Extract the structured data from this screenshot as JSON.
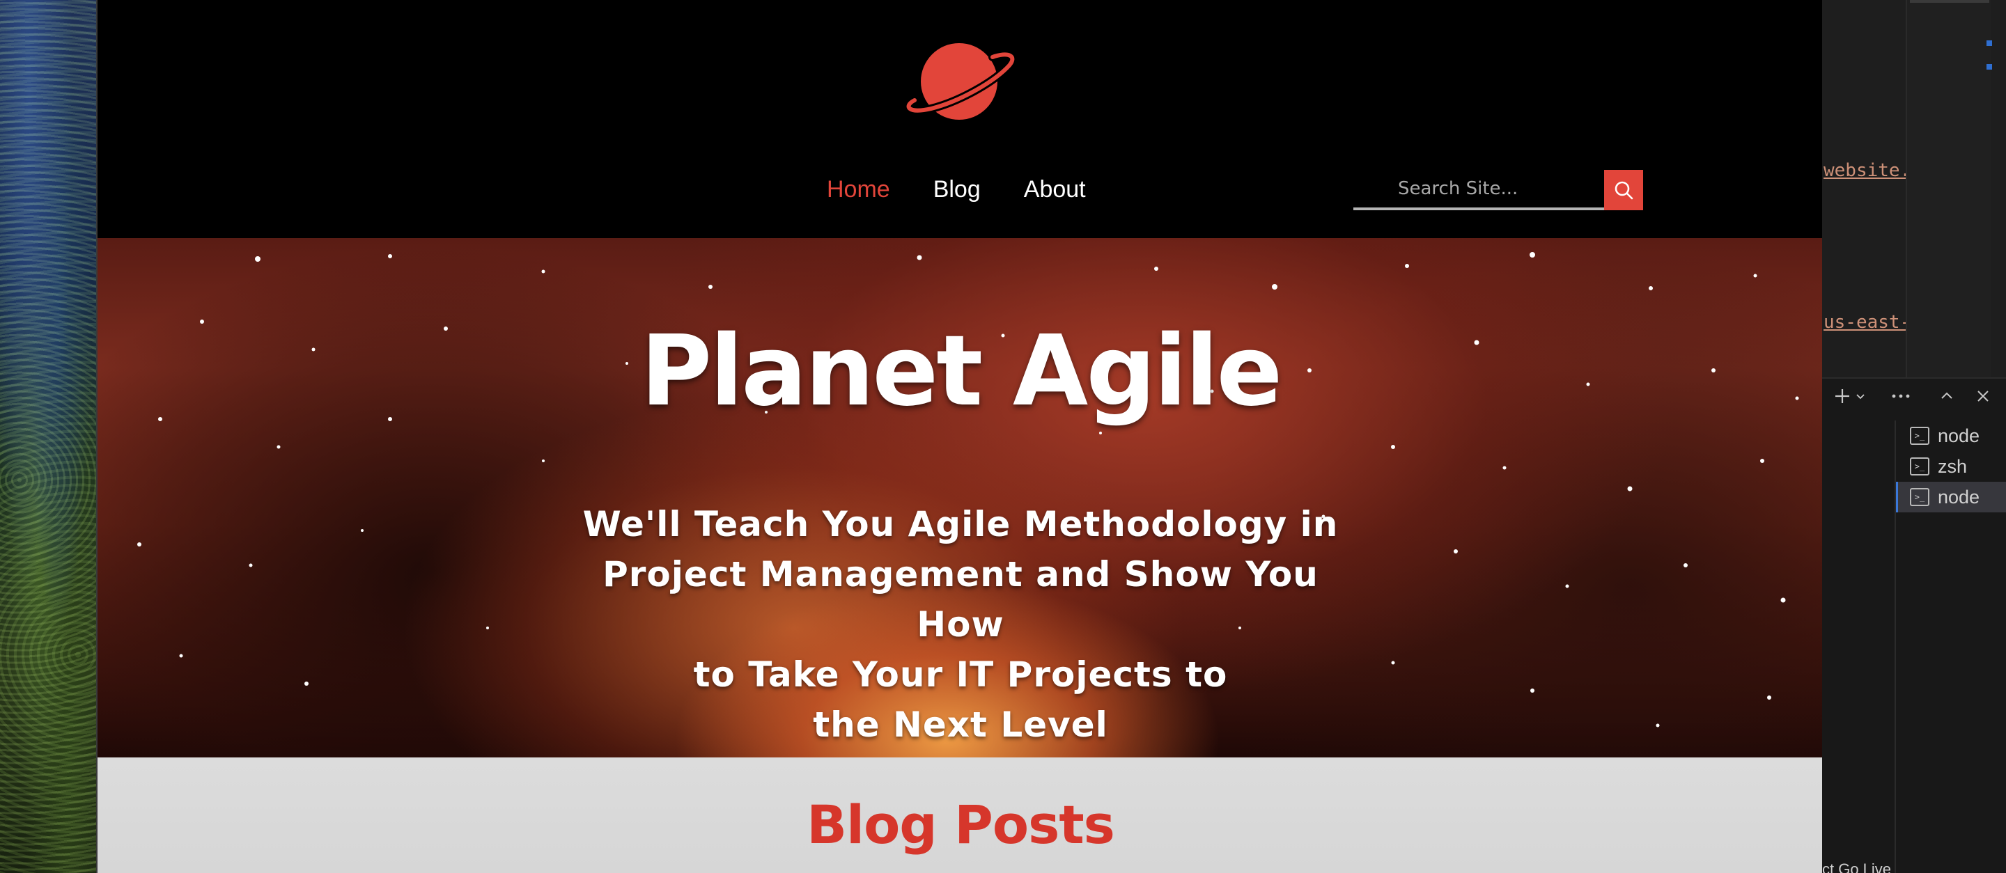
{
  "site": {
    "logo_name": "planet-logo",
    "nav": [
      {
        "label": "Home",
        "active": true
      },
      {
        "label": "Blog",
        "active": false
      },
      {
        "label": "About",
        "active": false
      }
    ],
    "search": {
      "placeholder": "Search Site..."
    },
    "hero": {
      "title": "Planet Agile",
      "tagline_lines": [
        "We'll Teach You Agile Methodology in",
        "Project Management and Show You How",
        "to Take Your IT Projects to",
        "the Next Level"
      ]
    },
    "blog": {
      "title": "Blog Posts"
    }
  },
  "editor": {
    "code_lines": [
      "website.",
      "us-east-"
    ],
    "terminals": [
      {
        "label": "node",
        "active": false
      },
      {
        "label": "zsh",
        "active": false
      },
      {
        "label": "node",
        "active": true
      }
    ],
    "status_bar": "ct   Go Live"
  },
  "colors": {
    "accent": "#e2453a",
    "blog_title": "#d6362b",
    "nav_text": "#ffffff"
  }
}
